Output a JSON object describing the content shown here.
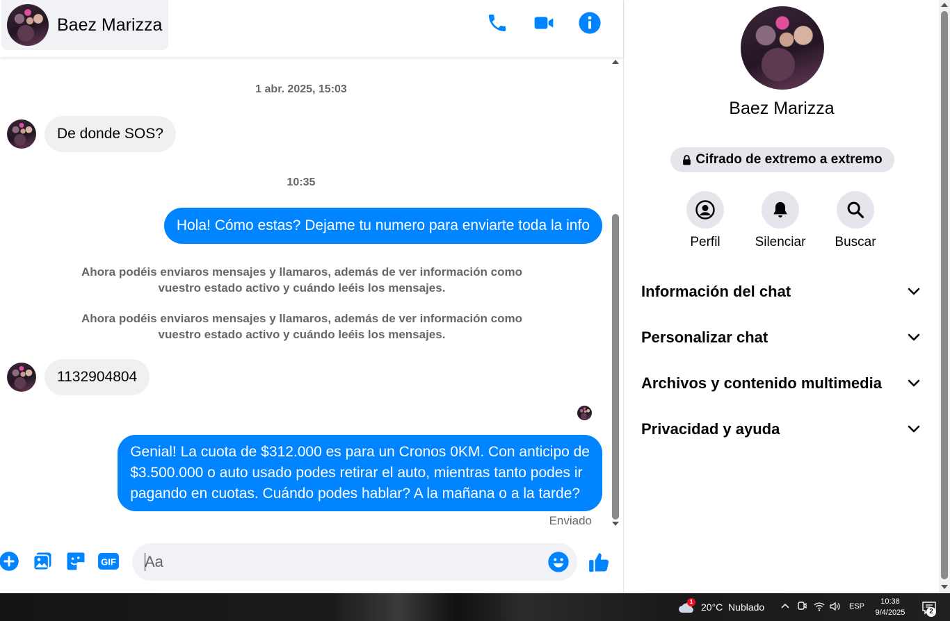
{
  "header": {
    "contact_name": "Baez Marizza",
    "icons": [
      "phone-icon",
      "video-camera-icon",
      "info-icon"
    ],
    "accent_color": "#0084ff"
  },
  "messages": {
    "timestamp_1": "1 abr. 2025, 15:03",
    "in_1": "De donde SOS?",
    "timestamp_2": "10:35",
    "out_1": "Hola! Cómo estas? Dejame tu numero para enviarte toda la info",
    "system_1_line1": "Ahora podéis enviaros mensajes y llamaros, además de ver información como",
    "system_1_line2": "vuestro estado activo y cuándo leéis los mensajes.",
    "system_2_line1": "Ahora podéis enviaros mensajes y llamaros, además de ver información como",
    "system_2_line2": "vuestro estado activo y cuándo leéis los mensajes.",
    "in_2": "1132904804",
    "out_2_line1": "Genial! La cuota de $312.000 es para un Cronos 0KM. Con anticipo de",
    "out_2_line2": "$3.500.000 o auto usado podes retirar el auto, mientras tanto podes ir",
    "out_2_line3": "pagando en cuotas. Cuándo podes hablar? A la mañana o a la tarde?",
    "status": "Enviado"
  },
  "composer": {
    "placeholder": "Aa",
    "gif_label": "GIF",
    "icons": [
      "plus-icon",
      "photo-icon",
      "sticker-icon",
      "gif-icon",
      "emoji-icon",
      "thumbs-up-icon"
    ]
  },
  "details": {
    "name": "Baez Marizza",
    "encryption_badge": "Cifrado de extremo a extremo",
    "actions": [
      {
        "label": "Perfil",
        "icon": "profile-icon"
      },
      {
        "label": "Silenciar",
        "icon": "bell-icon"
      },
      {
        "label": "Buscar",
        "icon": "search-icon"
      }
    ],
    "sections": [
      "Información del chat",
      "Personalizar chat",
      "Archivos y contenido multimedia",
      "Privacidad y ayuda"
    ]
  },
  "taskbar": {
    "weather_badge": "1",
    "weather": "20°C  Nublado",
    "language": "ESP",
    "time": "10:38",
    "date": "9/4/2025",
    "notifications": "2"
  }
}
